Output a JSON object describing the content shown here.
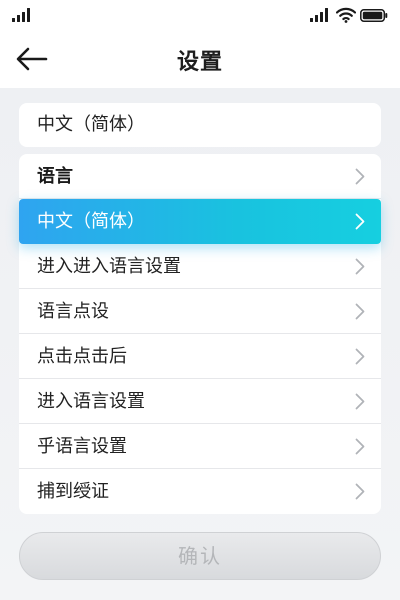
{
  "header": {
    "title": "设置"
  },
  "current_language": {
    "value": "中文（简体）"
  },
  "list": {
    "items": [
      {
        "label": "语言",
        "kind": "section-header",
        "chevron_icon": "chevron-right-icon"
      },
      {
        "label": "中文（简体）",
        "kind": "selected",
        "chevron_icon": "chevron-right-icon"
      },
      {
        "label": "进入进入语言设置",
        "kind": "normal",
        "chevron_icon": "chevron-right-icon"
      },
      {
        "label": "语言点设",
        "kind": "normal",
        "chevron_icon": "chevron-right-icon"
      },
      {
        "label": "点击点击后",
        "kind": "normal",
        "chevron_icon": "chevron-right-icon"
      },
      {
        "label": "进入语言设置",
        "kind": "normal",
        "chevron_icon": "chevron-right-icon"
      },
      {
        "label": "乎语言设置",
        "kind": "normal",
        "chevron_icon": "chevron-right-icon"
      },
      {
        "label": "捕到绶证",
        "kind": "normal",
        "chevron_icon": "chevron-right-icon"
      }
    ]
  },
  "footer": {
    "confirm_label": "确认"
  },
  "colors": {
    "selected_gradient_start": "#2fa4f0",
    "selected_gradient_end": "#16cfe0",
    "text_primary": "#222222",
    "chevron": "#b0b3b8",
    "disabled_button_text": "#b4b6b9"
  },
  "icons": {
    "back": "arrow-left-icon",
    "signal": "cellular-signal-icon",
    "wifi": "wifi-icon",
    "battery": "battery-icon"
  }
}
